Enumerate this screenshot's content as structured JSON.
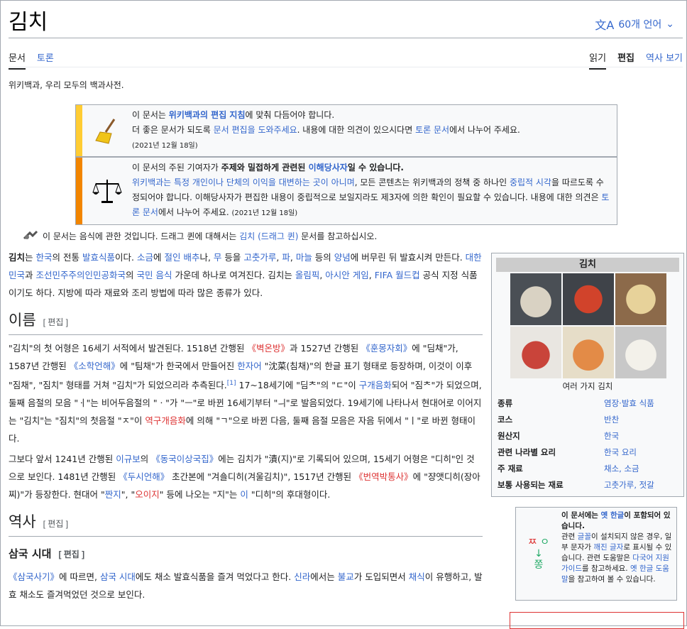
{
  "title": "김치",
  "lang_button": "60개 언어",
  "tabs_left": [
    "문서",
    "토론"
  ],
  "tabs_right": [
    "읽기",
    "편집",
    "역사 보기"
  ],
  "tagline": "위키백과, 우리 모두의 백과사전.",
  "notice1": {
    "a": "이 문서는 ",
    "b": "위키백과의 편집 지침",
    "c": "에 맞춰 다듬어야 합니다.",
    "d": "더 좋은 문서가 되도록 ",
    "e": "문서 편집을 도와주세요",
    "f": ". 내용에 대한 의견이 있으시다면 ",
    "g": "토론 문서",
    "h": "에서 나누어 주세요.",
    "date": "(2021년 12월 18일)"
  },
  "notice2": {
    "a": "이 문서의 주된 기여자가 ",
    "b": "주제와 밀접하게 관련된 ",
    "c": "이해당사자",
    "d": "일 수 있습니다.",
    "e": "위키백과는 특정 개인이나 단체의 이익을 대변하는 곳이 아니며",
    "f": ", 모든 콘텐츠는 위키백과의 정책 중 하나인 ",
    "g": "중립적 시각",
    "h": "을 따르도록 수정되어야 합니다. 이해당사자가 편집한 내용이 중립적으로 보일지라도 제3자에 의한 확인이 필요할 수 있습니다. 내용에 대한 의견은 ",
    "i": "토론 문서",
    "j": "에서 나누어 주세요.",
    "date": "(2021년 12월 18일)"
  },
  "hatnote": {
    "a": "이 문서는 음식에 관한 것입니다. 드래그 퀸에 대해서는 ",
    "b": "김치 (드래그 퀸)",
    "c": " 문서를 참고하십시오."
  },
  "intro": {
    "p1": "김치",
    "p2": "는 ",
    "p3": "한국",
    "p4": "의 전통 ",
    "p5": "발효식품",
    "p6": "이다. ",
    "p7": "소금",
    "p8": "에 ",
    "p9": "절인",
    "p10": " ",
    "p11": "배추",
    "p12": "나, ",
    "p13": "무",
    "p14": " 등을 ",
    "p15": "고춧가루",
    "p16": ", ",
    "p17": "파",
    "p18": ", ",
    "p19": "마늘",
    "p20": " 등의 ",
    "p21": "양념",
    "p22": "에 버무린 뒤 발효시켜 만든다. ",
    "p23": "대한민국",
    "p24": "과 ",
    "p25": "조선민주주의인민공화국",
    "p26": "의 ",
    "p27": "국민 음식",
    "p28": " 가운데 하나로 여겨진다. 김치는 ",
    "p29": "올림픽",
    "p30": ", ",
    "p31": "아시안 게임",
    "p32": ", ",
    "p33": "FIFA 월드컵",
    "p34": " 공식 지정 식품이기도 하다. 지방에 따라 재료와 조리 방법에 따라 많은 종류가 있다."
  },
  "section_name": {
    "title": "이름",
    "edit": "[ 편집 ]"
  },
  "name_p1": {
    "a": "\"김치\"의 첫 어형은 16세기 서적에서 발견된다. 1518년 간행된 ",
    "b": "《벽온방》",
    "c": "과 1527년 간행된 ",
    "d": "《훈몽자회》",
    "e": "에 \"딤채\"가, 1587년 간행된 ",
    "f": "《소학언해》",
    "g": "에 \"팀채\"가 한국에서 만들어진 ",
    "h": "한자어",
    "i": " \"沈菜(침채)\"의 한글 표기 형태로 등장하며, 이것이 이후 \"짐채\", \"짐치\" 형태를 거쳐 \"김치\"가 되었으리라 추측된다.",
    "sup": "[1]",
    "j": " 17~18세기에 \"딤ᄎ\"의 \"ㄷ\"이 ",
    "k": "구개음화",
    "l": "되어 \"짐ᄎ\"가 되었으며, 둘째 음절의 모음 \"ㆎ\"는 비어두음절의 \"ㆍ\"가 \"ㅡ\"로 바뀐 16세기부터 \"ㅢ\"로 발음되었다. 19세기에 나타나서 현대어로 이어지는 \"김치\"는 \"짐치\"의 첫음절 \"ㅈ\"이 ",
    "m": "역구개음화",
    "n": "에 의해 \"ㄱ\"으로 바뀐 다음, 둘째 음절 모음은 자음 뒤에서 \"ㅣ\"로 바뀐 형태이다."
  },
  "name_p2": {
    "a": "그보다 앞서 1241년 간행된 ",
    "b": "이규보",
    "c": "의 ",
    "d": "《동국이상국집》",
    "e": "에는 김치가 \"漬(지)\"로 기록되어 있으며, 15세기 어형은 \"디히\"인 것으로 보인다. 1481년 간행된 ",
    "f": "《두시언해》",
    "g": " 초간본에 \"겨ᅀᅳᆯ디히(겨울김치)\", 1517년 간행된 ",
    "h": "《번역박통사》",
    "i": "에 \"쟝앳디히(장아찌)\"가 등장한다. 현대어 \"",
    "j": "짠지",
    "k": "\", \"",
    "l": "오이지",
    "m": "\" 등에 나오는 \"지\"는 ",
    "n": "이",
    "o": " \"디히\"의 후대형이다."
  },
  "section_history": {
    "title": "역사",
    "edit": "[ 편집 ]"
  },
  "section_samguk": {
    "title": "삼국 시대",
    "edit": "[ 편집 ]"
  },
  "samguk_p": {
    "a": "《삼국사기》",
    "b": "에 따르면, ",
    "c": "삼국 시대",
    "d": "에도 채소 발효식품을 즐겨 먹었다고 한다. ",
    "e": "신라",
    "f": "에서는 ",
    "g": "불교",
    "h": "가 도입되면서 ",
    "i": "채식",
    "j": "이 유행하고, 발효 채소도 즐겨먹었던 것으로 보인다."
  },
  "infobox": {
    "title": "김치",
    "caption": "여러 가지 김치",
    "rows": [
      {
        "k": "종류",
        "v": "염장·발효 식품"
      },
      {
        "k": "코스",
        "v": "반찬"
      },
      {
        "k": "원산지",
        "v": "한국"
      },
      {
        "k": "관련 나라별 요리",
        "v": "한국 요리"
      },
      {
        "k": "주 재료",
        "v": "채소, 소금"
      },
      {
        "k": "보통 사용되는 재료",
        "v": "고춧가루, 젓갈"
      }
    ]
  },
  "fontbox": {
    "sym1": "ㅉ",
    "sym2": "ㅇ",
    "sym3": "↓",
    "sym4": "쫑",
    "a": "이 문서에는 ",
    "b": "옛 한글",
    "c": "이 포함되어 있습니다.",
    "d": "관련 ",
    "e": "글꼴",
    "f": "이 설치되지 않은 경우, 일부 문자가 ",
    "g": "깨진 글자",
    "h": "로 표시될 수 있습니다. 관련 도움말은 ",
    "i": "다국어 지원 가이드",
    "j": "를 참고하세요. ",
    "k": "옛 한글 도움말",
    "l": "을 참고하여 볼 수 있습니다."
  },
  "colors": {
    "link": "#3366cc",
    "redlink": "#dd3333",
    "notice_yellow": "#fc3",
    "notice_orange": "#f28500"
  }
}
